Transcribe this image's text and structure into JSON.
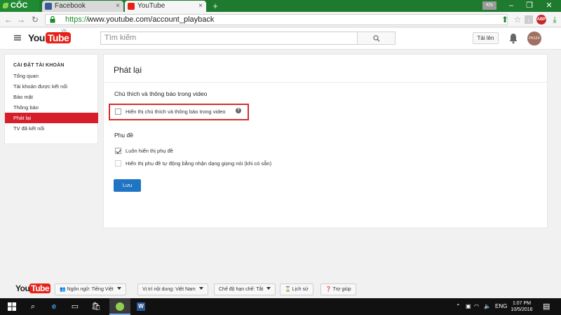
{
  "browser": {
    "brand": "CỐC CỐC",
    "tabs": [
      {
        "label": "Facebook",
        "favicon": "facebook-icon",
        "active": false
      },
      {
        "label": "YouTube",
        "favicon": "youtube-icon",
        "active": true
      }
    ],
    "profile_chip": "KN",
    "url_protocol": "https://",
    "url_host": "www.youtube.com/account_playback",
    "colors": {
      "tabstrip": "#1e7a2e",
      "secure": "#1a8a2a"
    }
  },
  "header": {
    "logo_you": "You",
    "logo_tube": "Tube",
    "logo_region": "VN",
    "search_placeholder": "Tìm kiếm",
    "upload_label": "Tải lên",
    "avatar_text": "PK1Z4"
  },
  "sidebar": {
    "heading": "CÀI ĐẶT TÀI KHOẢN",
    "items": [
      {
        "label": "Tổng quan",
        "active": false
      },
      {
        "label": "Tài khoản được kết nối",
        "active": false
      },
      {
        "label": "Bảo mật",
        "active": false
      },
      {
        "label": "Thông báo",
        "active": false
      },
      {
        "label": "Phát lại",
        "active": true
      },
      {
        "label": "TV đã kết nối",
        "active": false
      }
    ],
    "active_color": "#d61f2b"
  },
  "main": {
    "title": "Phát lại",
    "annotations_section": "Chú thích và thông báo trong video",
    "annotations_checkbox": {
      "label": "Hiển thị chú thích và thông báo trong video",
      "checked": false
    },
    "subtitles_section": "Phụ đề",
    "subtitles_always": {
      "label": "Luôn hiển thị phụ đề",
      "checked": true
    },
    "subtitles_auto": {
      "label": "Hiển thị phụ đề tự động bằng nhận dạng giọng nói (khi có sẵn)",
      "checked": false
    },
    "save_label": "Lưu",
    "highlight_color": "#d32f2f",
    "save_color": "#1f74c4"
  },
  "footer": {
    "logo_you": "You",
    "logo_tube": "Tube",
    "language": "Ngôn ngữ: Tiếng Việt",
    "location": "Vị trí nội dung: Việt Nam",
    "restricted": "Chế độ hạn chế: Tắt",
    "history": "Lịch sử",
    "help": "Trợ giúp"
  },
  "taskbar": {
    "lang": "ENG",
    "time": "1:07 PM",
    "date": "10/5/2016",
    "icons": [
      "windows-start-icon",
      "search-icon",
      "edge-icon",
      "task-view-icon",
      "store-icon",
      "coccoc-icon",
      "word-icon"
    ]
  }
}
